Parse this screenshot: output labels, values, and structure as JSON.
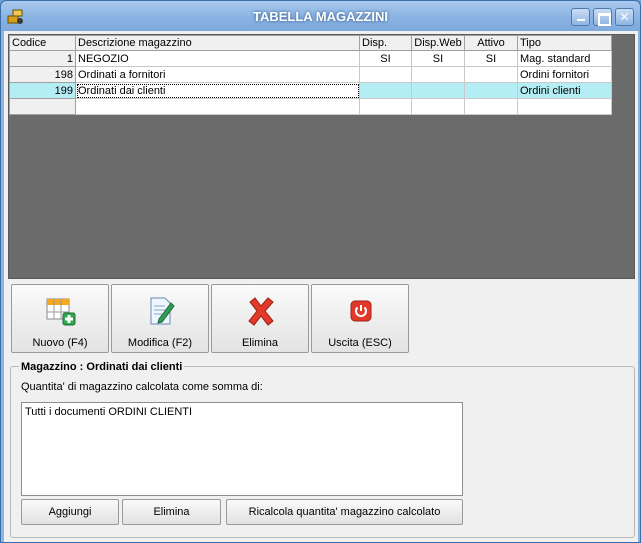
{
  "window": {
    "title": "TABELLA MAGAZZINI",
    "icon": "warehouse-app-icon",
    "controls": [
      "minimize-icon",
      "maximize-icon",
      "close-icon"
    ]
  },
  "grid": {
    "columns": [
      "Codice",
      "Descrizione magazzino",
      "Disp.",
      "Disp.Web",
      "Attivo",
      "Tipo"
    ],
    "rows": [
      {
        "code": "1",
        "desc": "NEGOZIO",
        "disp": "SI",
        "dispweb": "SI",
        "attivo": "SI",
        "tipo": "Mag. standard"
      },
      {
        "code": "198",
        "desc": "Ordinati a fornitori",
        "disp": "",
        "dispweb": "",
        "attivo": "",
        "tipo": "Ordini fornitori"
      },
      {
        "code": "199",
        "desc": "Ordinati dai clienti",
        "disp": "",
        "dispweb": "",
        "attivo": "",
        "tipo": "Ordini clienti"
      },
      {
        "code": "",
        "desc": "",
        "disp": "",
        "dispweb": "",
        "attivo": "",
        "tipo": ""
      }
    ],
    "selected_row_index": 2,
    "selected_color": "#b4eef4"
  },
  "toolbar": {
    "new_label": "Nuovo (F4)",
    "edit_label": "Modifica (F2)",
    "delete_label": "Elimina",
    "exit_label": "Uscita (ESC)"
  },
  "detail": {
    "title": "Magazzino : Ordinati dai clienti",
    "subtitle": "Quantita' di magazzino calcolata come somma di:",
    "memo_text": "Tutti i documenti ORDINI CLIENTI",
    "add_label": "Aggiungi",
    "remove_label": "Elimina",
    "recalc_label": "Ricalcola quantita' magazzino calcolato"
  }
}
